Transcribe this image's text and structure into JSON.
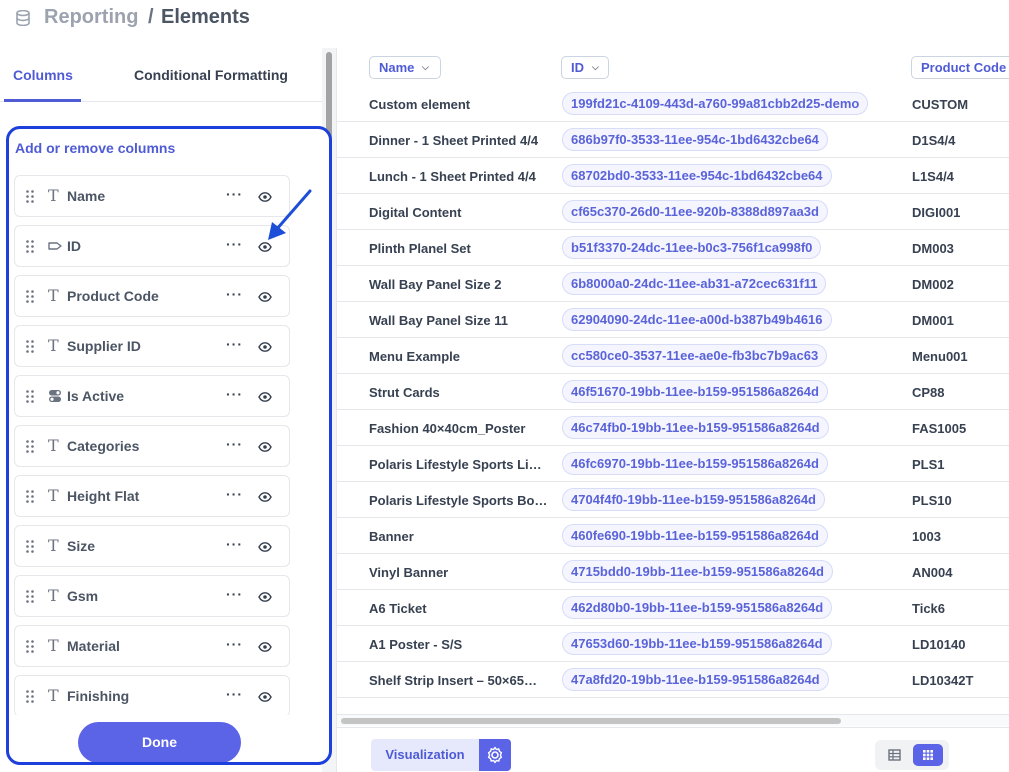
{
  "header": {
    "section": "Reporting",
    "separator": "/",
    "title": "Elements",
    "icon": "database-icon"
  },
  "tabs": [
    {
      "label": "Columns",
      "active": true
    },
    {
      "label": "Conditional Formatting",
      "active": false
    }
  ],
  "columns_panel": {
    "heading": "Add or remove columns",
    "items": [
      {
        "label": "Name",
        "type_icon": "text-type-icon"
      },
      {
        "label": "ID",
        "type_icon": "tag-type-icon"
      },
      {
        "label": "Product Code",
        "type_icon": "text-type-icon"
      },
      {
        "label": "Supplier ID",
        "type_icon": "text-type-icon"
      },
      {
        "label": "Is Active",
        "type_icon": "toggle-type-icon"
      },
      {
        "label": "Categories",
        "type_icon": "text-type-icon"
      },
      {
        "label": "Height Flat",
        "type_icon": "text-type-icon"
      },
      {
        "label": "Size",
        "type_icon": "text-type-icon"
      },
      {
        "label": "Gsm",
        "type_icon": "text-type-icon"
      },
      {
        "label": "Material",
        "type_icon": "text-type-icon"
      },
      {
        "label": "Finishing",
        "type_icon": "text-type-icon"
      }
    ],
    "more_label": "···",
    "done_label": "Done"
  },
  "table": {
    "headers": [
      {
        "label": "Name"
      },
      {
        "label": "ID"
      },
      {
        "label": "Product Code"
      }
    ],
    "rows": [
      {
        "name": "Custom element",
        "id": "199fd21c-4109-443d-a760-99a81cbb2d25-demo",
        "code": "CUSTOM"
      },
      {
        "name": "Dinner - 1 Sheet Printed 4/4",
        "id": "686b97f0-3533-11ee-954c-1bd6432cbe64",
        "code": "D1S4/4"
      },
      {
        "name": "Lunch - 1 Sheet Printed 4/4",
        "id": "68702bd0-3533-11ee-954c-1bd6432cbe64",
        "code": "L1S4/4"
      },
      {
        "name": "Digital Content",
        "id": "cf65c370-26d0-11ee-920b-8388d897aa3d",
        "code": "DIGI001"
      },
      {
        "name": "Plinth Planel Set",
        "id": "b51f3370-24dc-11ee-b0c3-756f1ca998f0",
        "code": "DM003"
      },
      {
        "name": "Wall Bay Panel Size 2",
        "id": "6b8000a0-24dc-11ee-ab31-a72cec631f11",
        "code": "DM002"
      },
      {
        "name": "Wall Bay Panel Size 11",
        "id": "62904090-24dc-11ee-a00d-b387b49b4616",
        "code": "DM001"
      },
      {
        "name": "Menu Example",
        "id": "cc580ce0-3537-11ee-ae0e-fb3bc7b9ac63",
        "code": "Menu001"
      },
      {
        "name": "Strut Cards",
        "id": "46f51670-19bb-11ee-b159-951586a8264d",
        "code": "CP88"
      },
      {
        "name": "Fashion 40×40cm_Poster",
        "id": "46c74fb0-19bb-11ee-b159-951586a8264d",
        "code": "FAS1005"
      },
      {
        "name": "Polaris Lifestyle Sports Li…",
        "id": "46fc6970-19bb-11ee-b159-951586a8264d",
        "code": "PLS1"
      },
      {
        "name": "Polaris Lifestyle Sports Bo…",
        "id": "4704f4f0-19bb-11ee-b159-951586a8264d",
        "code": "PLS10"
      },
      {
        "name": "Banner",
        "id": "460fe690-19bb-11ee-b159-951586a8264d",
        "code": "1003"
      },
      {
        "name": "Vinyl Banner",
        "id": "4715bdd0-19bb-11ee-b159-951586a8264d",
        "code": "AN004"
      },
      {
        "name": "A6 Ticket",
        "id": "462d80b0-19bb-11ee-b159-951586a8264d",
        "code": "Tick6"
      },
      {
        "name": "A1 Poster - S/S",
        "id": "47653d60-19bb-11ee-b159-951586a8264d",
        "code": "LD10140"
      },
      {
        "name": "Shelf Strip Insert – 50×65…",
        "id": "47a8fd20-19bb-11ee-b159-951586a8264d",
        "code": "LD10342T"
      }
    ]
  },
  "footer": {
    "visualization_label": "Visualization",
    "settings_icon": "gear-icon",
    "view_toggle": [
      "table-view-icon",
      "grid-view-icon"
    ],
    "active_view": "grid-view-icon"
  },
  "colors": {
    "accent": "#4f5bd5",
    "primary_button": "#5b63e6",
    "panel_highlight": "#1d3fdb"
  }
}
